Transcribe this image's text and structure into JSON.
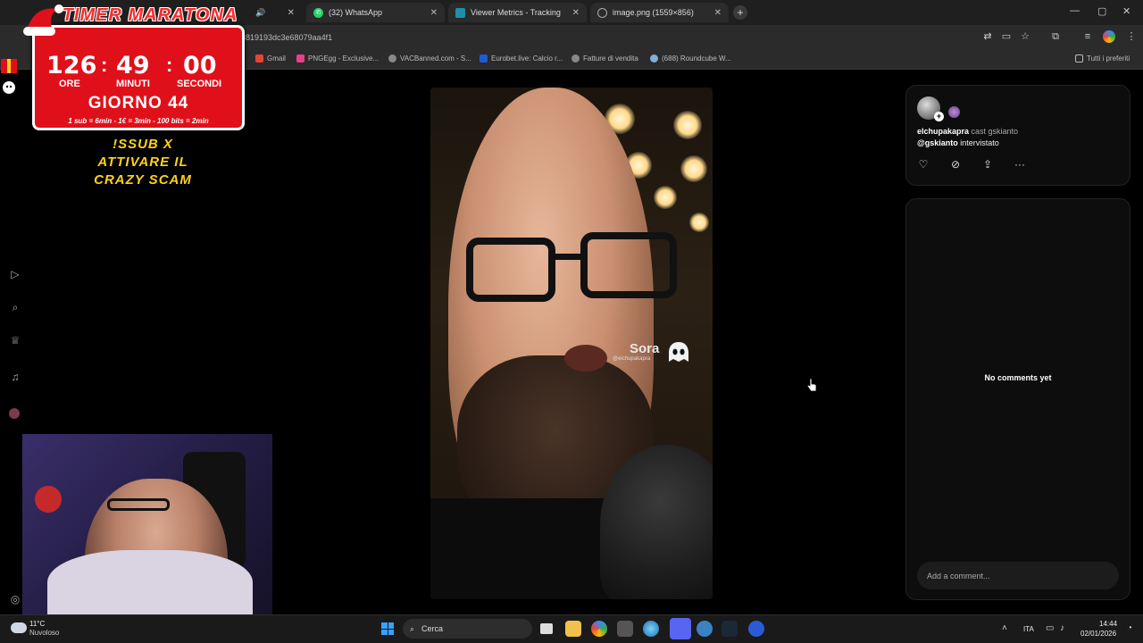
{
  "browser": {
    "tabs": [
      {
        "label": "",
        "name": "tab-audio"
      },
      {
        "label": "(32) WhatsApp",
        "name": "tab-whatsapp"
      },
      {
        "label": "Viewer Metrics - Tracking",
        "name": "tab-viewer-metrics"
      },
      {
        "label": "image.png (1559×856)",
        "name": "tab-image"
      }
    ],
    "url": "8819193dc3e68079aa4f1",
    "bookmarks": [
      {
        "label": "Gmail"
      },
      {
        "label": "PNGEgg - Exclusive..."
      },
      {
        "label": "VACBanned.com - S..."
      },
      {
        "label": "Eurobet.live: Calcio r..."
      },
      {
        "label": "Fatture di vendita"
      },
      {
        "label": "(688) Roundcube W..."
      }
    ],
    "all_bookmarks_label": "Tutti i preferiti"
  },
  "overlay": {
    "title": "TIMER MARATONA",
    "hours": "126",
    "minutes": "49",
    "seconds": "00",
    "hours_label": "ORE",
    "minutes_label": "MINUTI",
    "seconds_label": "SECONDI",
    "day": "GIORNO 44",
    "rates": "1 sub = 6min - 1€ = 3min - 100 bits = 2min",
    "promo_line1": "!SSUB X",
    "promo_line2": "ATTIVARE IL",
    "promo_line3": "CRAZY SCAM"
  },
  "video": {
    "watermark": "Sora",
    "watermark_handle": "@elchupakapra"
  },
  "post": {
    "author": "elchupakapra",
    "caption_rest": " cast gskianto",
    "mention": "@gskianto",
    "mention_rest": " intervistato",
    "no_comments": "No comments yet",
    "comment_placeholder": "Add a comment..."
  },
  "taskbar": {
    "temp": "11°C",
    "weather": "Nuvoloso",
    "search": "Cerca",
    "language": "ITA",
    "time": "14:44",
    "date": "02/01/2026"
  },
  "colors": {
    "timer_red": "#e0101a",
    "promo_yellow": "#ffd21a",
    "windows_blue": "#3aa0ff"
  }
}
